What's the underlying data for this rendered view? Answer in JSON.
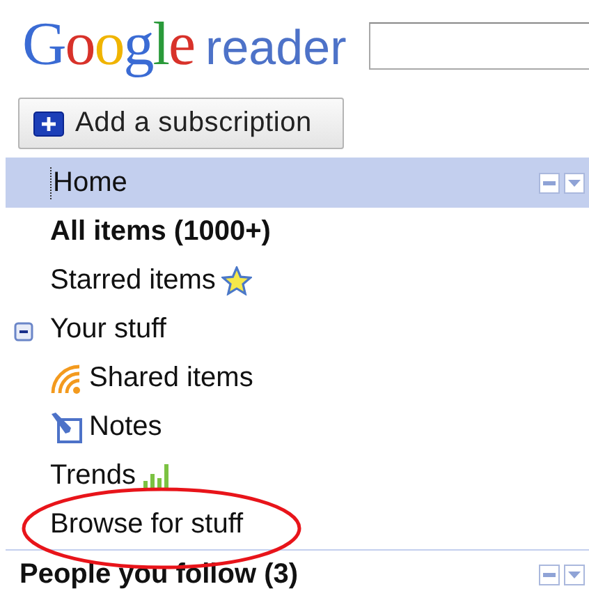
{
  "logo": {
    "brand": "Google",
    "product": "reader"
  },
  "add_button": {
    "label": "Add a subscription"
  },
  "nav": [
    {
      "label": "Home",
      "kind": "plain",
      "selected": true,
      "bold": false
    },
    {
      "label": "All items (1000+)",
      "kind": "plain",
      "selected": false,
      "bold": true
    },
    {
      "label": "Starred items",
      "kind": "starred",
      "selected": false,
      "bold": false
    },
    {
      "label": "Your stuff",
      "kind": "folder",
      "selected": false,
      "bold": false,
      "expanded": true,
      "children": [
        {
          "label": "Shared items",
          "kind": "shared",
          "selected": false,
          "bold": false
        },
        {
          "label": "Notes",
          "kind": "notes",
          "selected": false,
          "bold": false
        },
        {
          "label": "Trends",
          "kind": "trends",
          "selected": false,
          "bold": false
        },
        {
          "label": "Browse for stuff",
          "kind": "plain",
          "selected": false,
          "bold": false
        }
      ]
    }
  ],
  "people_section": {
    "title": "People you follow (3)"
  }
}
